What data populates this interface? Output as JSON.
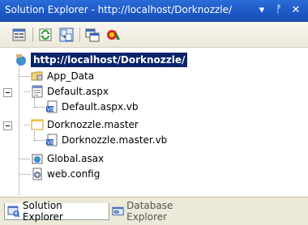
{
  "window": {
    "title": "Solution Explorer - http://localhost/Dorknozzle/",
    "controls": {
      "dropdown": "▾",
      "pin": "ᚡ",
      "close": "✕"
    }
  },
  "toolbar": {
    "buttons": [
      {
        "name": "properties-icon"
      },
      {
        "name": "refresh-icon"
      },
      {
        "name": "nest-related-files-icon"
      },
      {
        "name": "copy-web-site-icon"
      },
      {
        "name": "asp-net-configuration-icon"
      }
    ]
  },
  "tree": {
    "root": "http://localhost/Dorknozzle/",
    "items": {
      "app_data": "App_Data",
      "default_aspx": "Default.aspx",
      "default_aspx_vb": "Default.aspx.vb",
      "master": "Dorknozzle.master",
      "master_vb": "Dorknozzle.master.vb",
      "global": "Global.asax",
      "web_config": "web.config"
    }
  },
  "tabs": {
    "solution_explorer": "Solution Explorer",
    "database_explorer": "Database Explorer"
  },
  "colors": {
    "accent": "#0a246a",
    "titlebar": "#1c57c4"
  }
}
